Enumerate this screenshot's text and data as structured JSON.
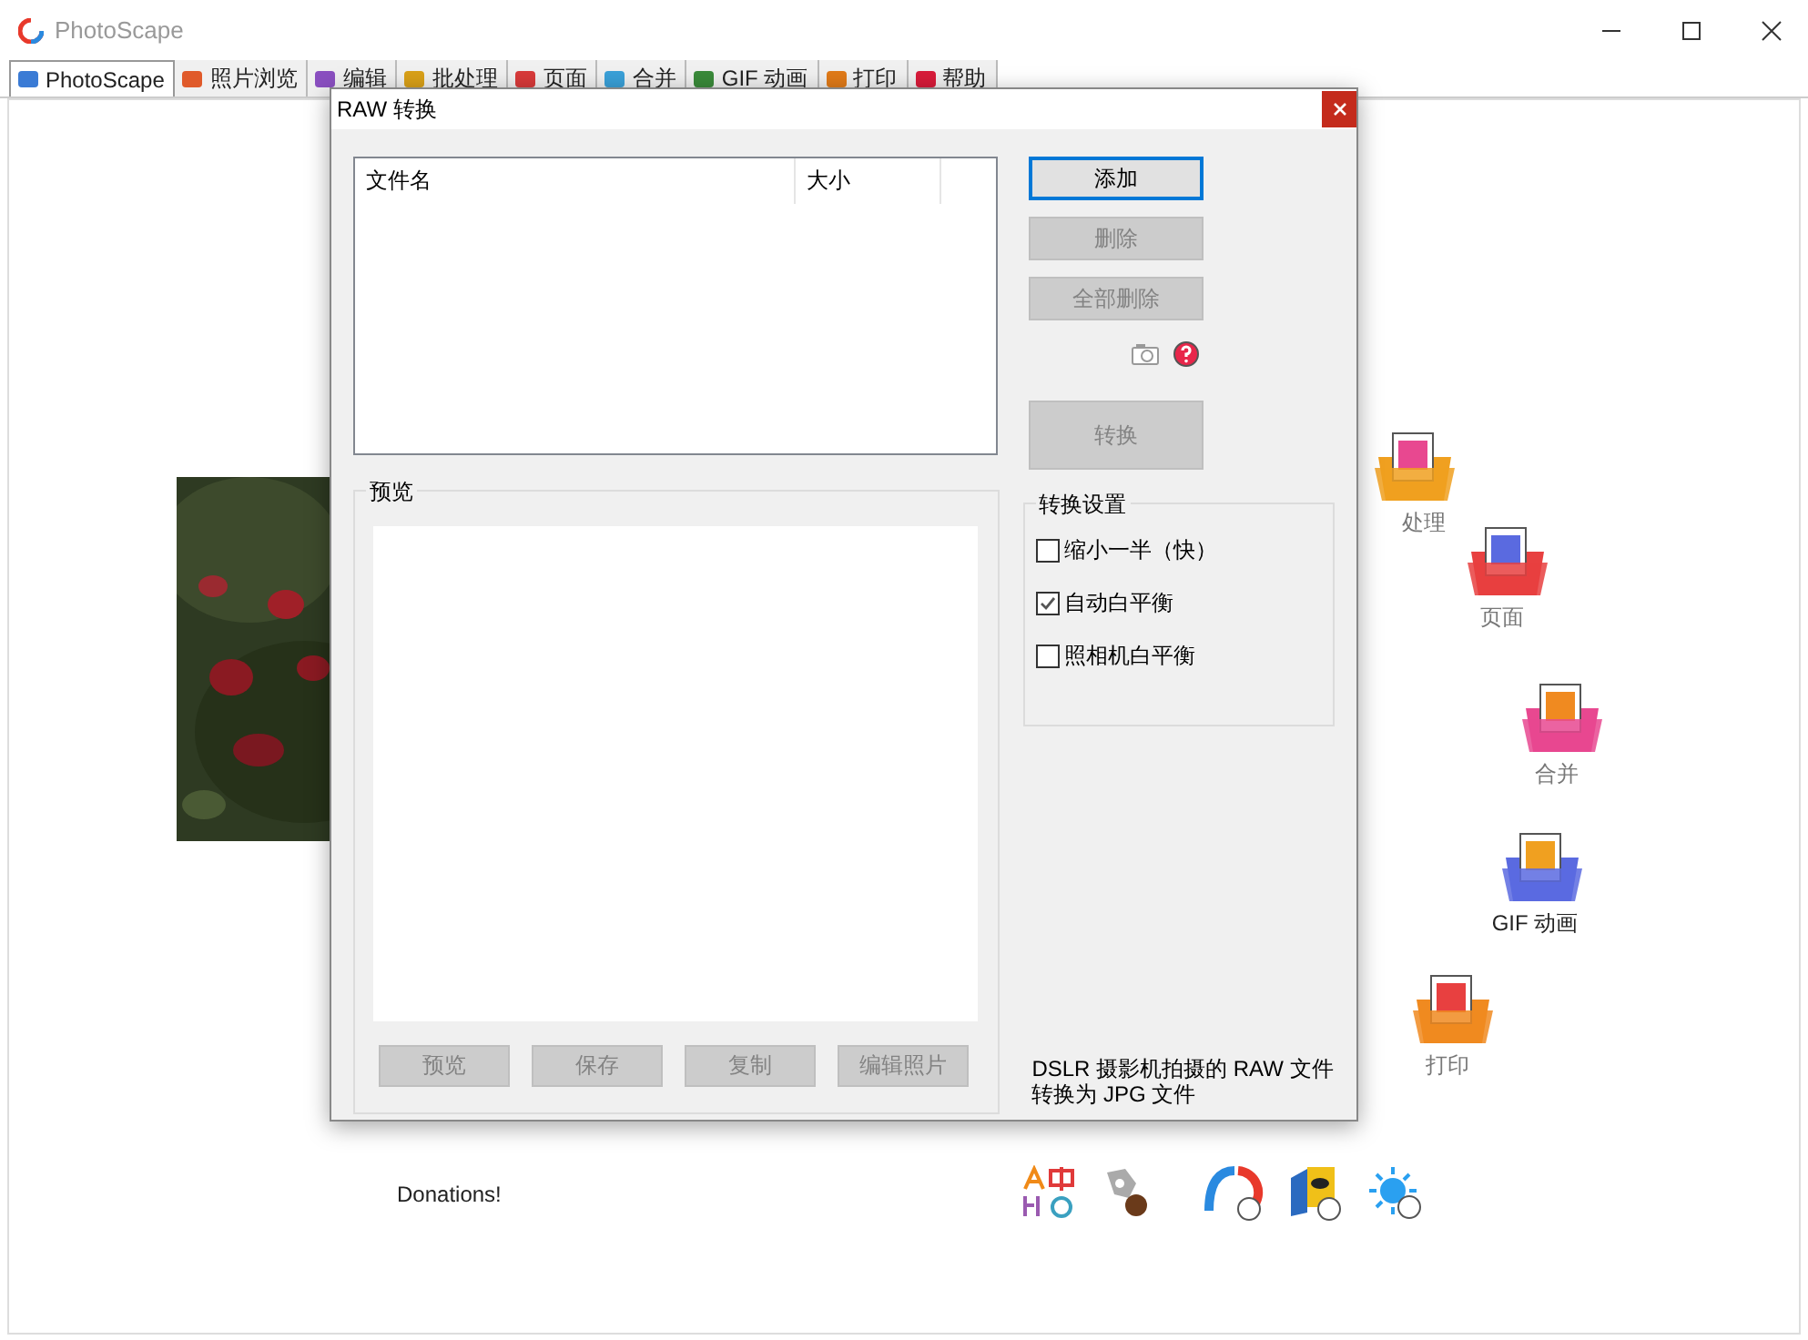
{
  "window": {
    "title": "PhotoScape"
  },
  "tabs": [
    {
      "label": "PhotoScape",
      "selected": true
    },
    {
      "label": "照片浏览",
      "selected": false
    },
    {
      "label": "编辑",
      "selected": false
    },
    {
      "label": "批处理",
      "selected": false
    },
    {
      "label": "页面",
      "selected": false
    },
    {
      "label": "合并",
      "selected": false
    },
    {
      "label": "GIF 动画",
      "selected": false
    },
    {
      "label": "打印",
      "selected": false
    },
    {
      "label": "帮助",
      "selected": false
    }
  ],
  "home": {
    "items": [
      {
        "label": "处理"
      },
      {
        "label": "页面"
      },
      {
        "label": "合并"
      },
      {
        "label": "GIF 动画"
      },
      {
        "label": "打印"
      }
    ],
    "donations": "Donations!"
  },
  "dialog": {
    "title": "RAW 转换",
    "file_list": {
      "columns": [
        "文件名",
        "大小"
      ]
    },
    "buttons": [
      {
        "label": "添加",
        "disabled": false,
        "focused": true
      },
      {
        "label": "删除",
        "disabled": true,
        "focused": false
      },
      {
        "label": "全部删除",
        "disabled": true,
        "focused": false
      }
    ],
    "convert_button": {
      "label": "转换",
      "disabled": true
    },
    "preview": {
      "title": "预览",
      "buttons": [
        {
          "label": "预览",
          "disabled": true
        },
        {
          "label": "保存",
          "disabled": true
        },
        {
          "label": "复制",
          "disabled": true
        },
        {
          "label": "编辑照片",
          "disabled": true
        }
      ]
    },
    "settings": {
      "title": "转换设置",
      "options": [
        {
          "label": "缩小一半（快）",
          "checked": false
        },
        {
          "label": "自动白平衡",
          "checked": true
        },
        {
          "label": "照相机白平衡",
          "checked": false
        }
      ]
    },
    "description": "DSLR 摄影机拍摄的 RAW 文件转换为 JPG 文件"
  }
}
